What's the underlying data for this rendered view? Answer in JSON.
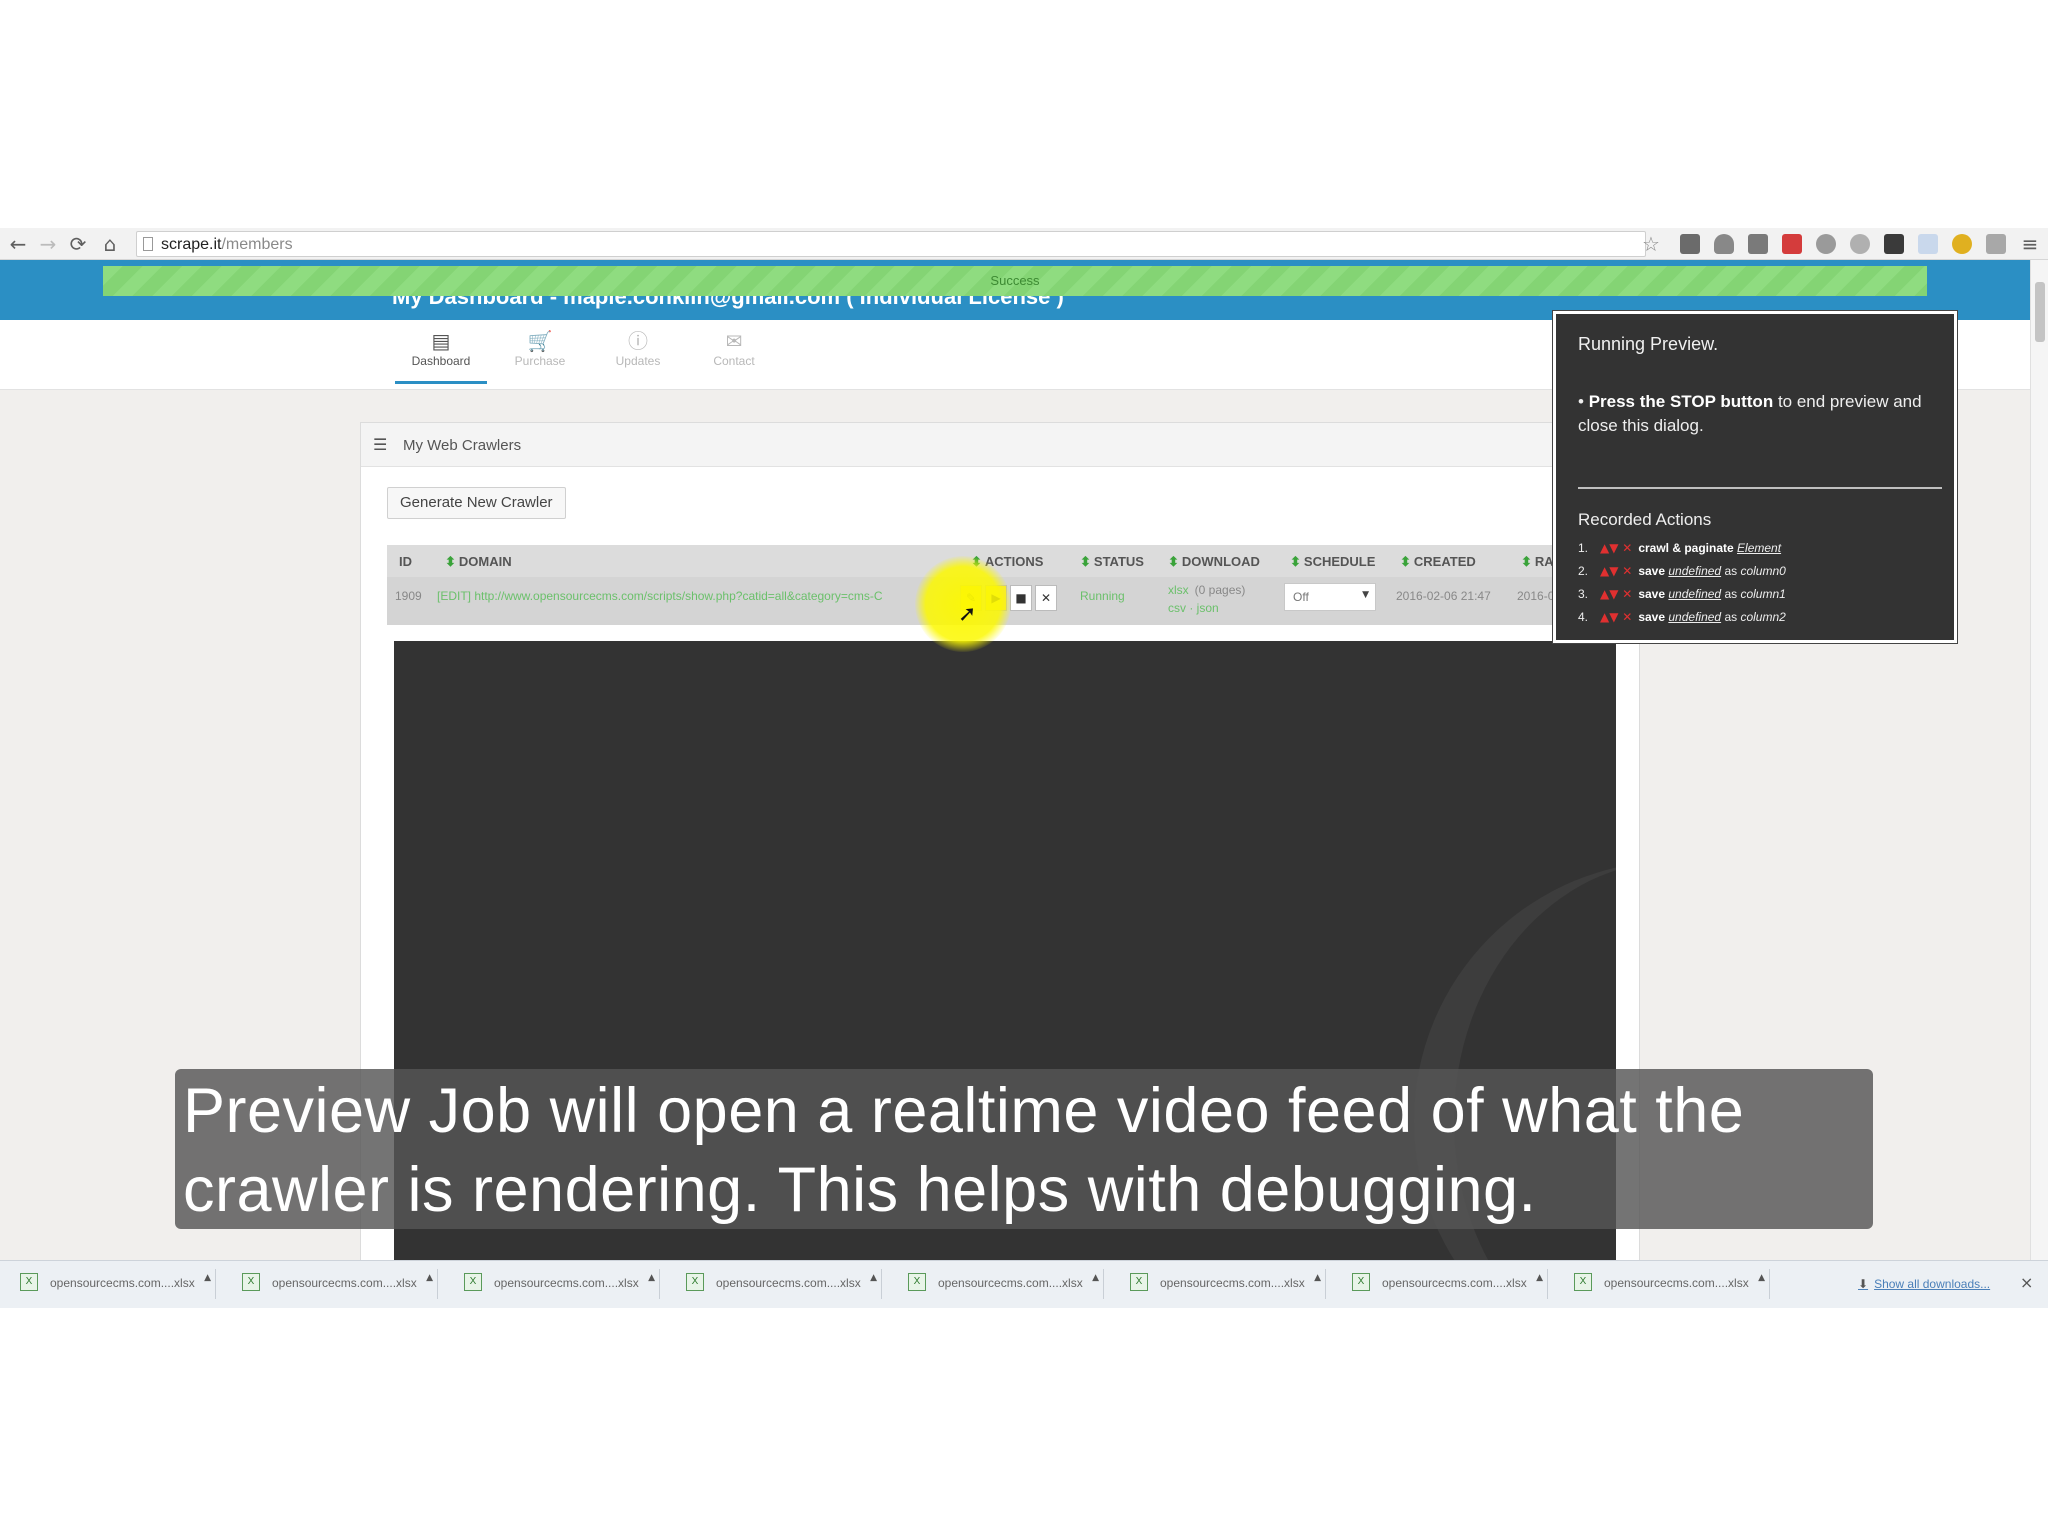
{
  "browser": {
    "url_host": "scrape.it",
    "url_path": "/members",
    "back_icon": "←",
    "forward_icon": "→",
    "reload_icon": "⟳",
    "home_icon": "⌂",
    "star_icon": "☆",
    "menu_icon": "≡"
  },
  "page": {
    "dashboard_title": "My Dashboard - maple.conklin@gmail.com ( Individual License )",
    "success_message": "Success",
    "nav_tabs": [
      {
        "label": "Dashboard",
        "icon": "▤",
        "active": true
      },
      {
        "label": "Purchase",
        "icon": "🛒",
        "active": false
      },
      {
        "label": "Updates",
        "icon": "ⓘ",
        "active": false
      },
      {
        "label": "Contact",
        "icon": "✉",
        "active": false
      }
    ],
    "panel_title": "My Web Crawlers",
    "panel_icon": "☰",
    "generate_button": "Generate New Crawler"
  },
  "table": {
    "headers": {
      "id": "ID",
      "domain": "DOMAIN",
      "actions": "ACTIONS",
      "status": "STATUS",
      "download": "DOWNLOAD",
      "schedule": "SCHEDULE",
      "created": "CREATED",
      "ran": "RA"
    },
    "sort_icon": "⬍",
    "row": {
      "id": "1909",
      "domain": "[EDIT] http://www.opensourcecms.com/scripts/show.php?catid=all&category=cms-C",
      "status": "Running",
      "download": "(0 pages)",
      "download_link": "xlsx",
      "download_link2": "csv  ·  json",
      "schedule": "Off",
      "created": "2016-02-06 21:47",
      "ran": "2016-0",
      "action_icons": [
        "✎",
        "▶",
        "■",
        "✕"
      ]
    }
  },
  "dialog": {
    "title": "Running Preview.",
    "message_bold": "Press the STOP button",
    "message_rest": " to end preview and close this dialog.",
    "recorded_title": "Recorded Actions",
    "actions": [
      {
        "num": "1.",
        "verb": "crawl & paginate",
        "target": "Element",
        "as_text": "",
        "column": ""
      },
      {
        "num": "2.",
        "verb": "save",
        "target": "undefined",
        "as_text": "as",
        "column": "column0"
      },
      {
        "num": "3.",
        "verb": "save",
        "target": "undefined",
        "as_text": "as",
        "column": "column1"
      },
      {
        "num": "4.",
        "verb": "save",
        "target": "undefined",
        "as_text": "as",
        "column": "column2"
      }
    ],
    "arrow_icons": "▲▼ ✕"
  },
  "caption": "Preview Job will open a realtime video feed of what the crawler is rendering. This helps with debugging.",
  "downloads": {
    "items": [
      "opensourcecms.com....xlsx",
      "opensourcecms.com....xlsx",
      "opensourcecms.com....xlsx",
      "opensourcecms.com....xlsx",
      "opensourcecms.com....xlsx",
      "opensourcecms.com....xlsx",
      "opensourcecms.com....xlsx",
      "opensourcecms.com....xlsx"
    ],
    "show_all": "Show all downloads...",
    "close_icon": "×",
    "download_icon": "⬇"
  },
  "colors": {
    "header_blue": "#2b8fc4",
    "success_green": "#8fdc80",
    "dialog_bg": "#333333",
    "highlight_yellow": "#fcf800"
  }
}
